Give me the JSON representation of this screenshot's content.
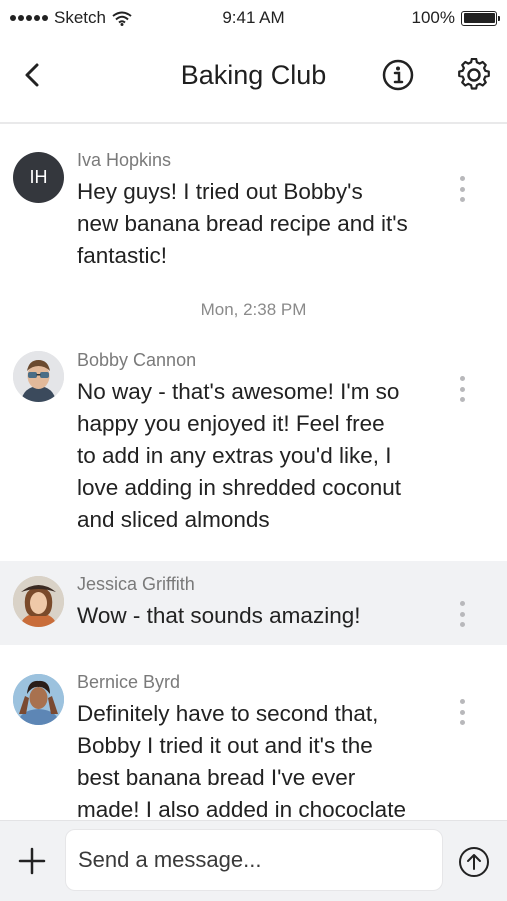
{
  "status_bar": {
    "carrier": "Sketch",
    "time": "9:41 AM",
    "battery": "100%"
  },
  "header": {
    "title": "Baking Club",
    "icons": {
      "back": "chevron-left-icon",
      "info": "info-icon",
      "settings": "gear-icon"
    }
  },
  "messages": [
    {
      "sender": "Iva Hopkins",
      "initials": "IH",
      "lines": [
        "Hey guys! I tried out Bobby's",
        "new banana bread recipe and it's",
        "fantastic!"
      ]
    },
    {
      "sender": "Bobby Cannon",
      "lines": [
        "No way - that's awesome! I'm so",
        "happy you enjoyed it! Feel free",
        "to add in any extras you'd like, I",
        "love adding in shredded coconut",
        "and sliced almonds"
      ]
    },
    {
      "sender": "Jessica Griffith",
      "lines": [
        "Wow - that sounds amazing!"
      ]
    },
    {
      "sender": "Bernice Byrd",
      "lines": [
        "Definitely have to second that,",
        "Bobby I tried it out and it's the",
        "best banana bread I've ever",
        "made! I also added in chococlate"
      ]
    }
  ],
  "timestamp": "Mon, 2:38 PM",
  "composer": {
    "placeholder": "Send a message..."
  },
  "colors": {
    "highlight_row": "#f1f2f4",
    "initials_avatar": "#34373d"
  }
}
